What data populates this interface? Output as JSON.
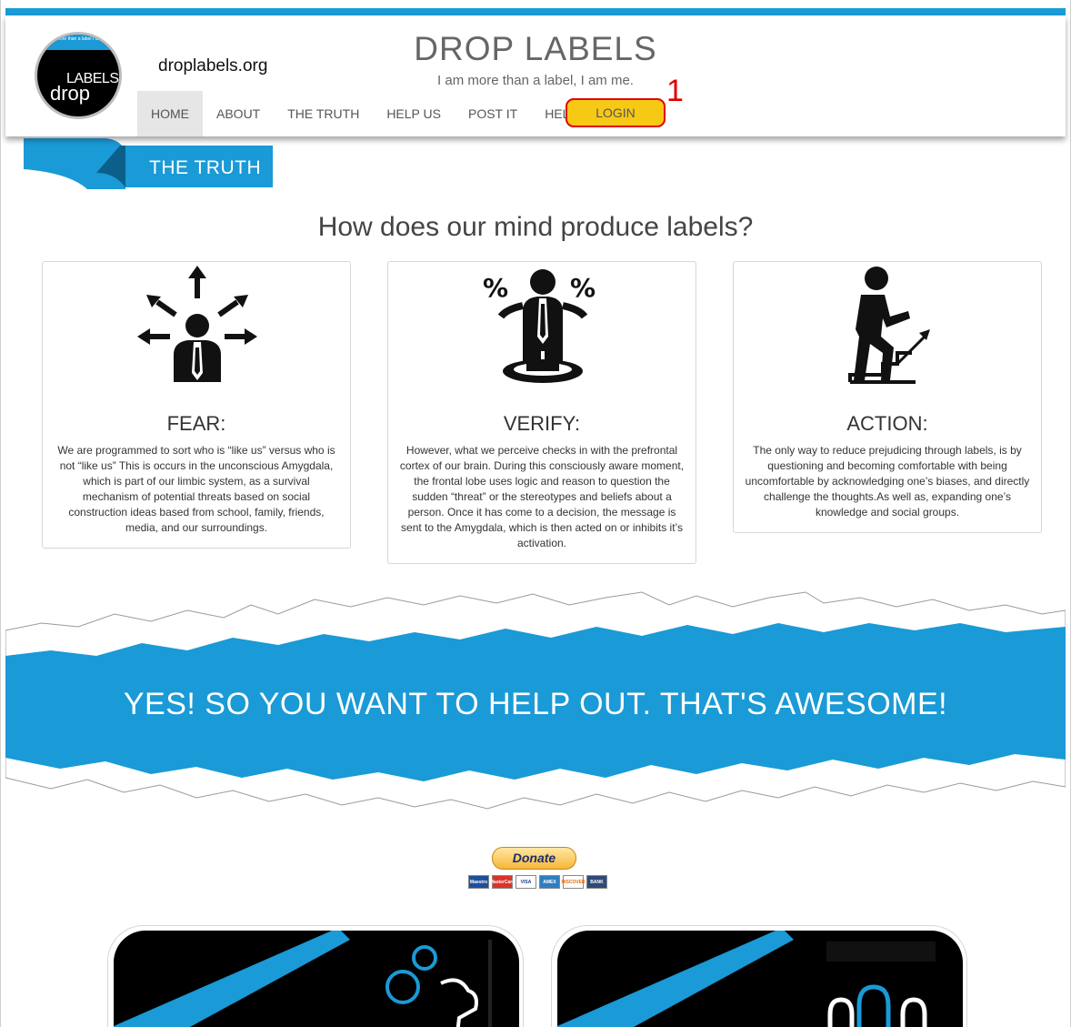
{
  "header": {
    "site_url": "droplabels.org",
    "title": "DROP LABELS",
    "tagline": "I am more than a label, I am me.",
    "logo": {
      "strip_text": "I am more than a label I am me.",
      "word_labels": "LABELS",
      "word_drop": "drop"
    }
  },
  "nav": {
    "items": [
      {
        "label": "HOME",
        "active": true
      },
      {
        "label": "ABOUT"
      },
      {
        "label": "THE TRUTH"
      },
      {
        "label": "HELP US"
      },
      {
        "label": "POST IT"
      },
      {
        "label": "HELP"
      }
    ],
    "login_label": "LOGIN",
    "annotation_number": "1"
  },
  "page_ribbon": {
    "label": "THE TRUTH"
  },
  "section": {
    "title": "How does our mind produce labels?",
    "cards": [
      {
        "icon": "person-arrows-icon",
        "title": "FEAR:",
        "body": "We are programmed to sort who is “like us” versus who is not “like us” This is occurs in the unconscious Amygdala, which is part of our limbic system, as a survival mechanism of potential threats based on social construction ideas based from school, family, friends, media, and our surroundings."
      },
      {
        "icon": "person-percent-icon",
        "title": "VERIFY:",
        "body": "However, what we perceive checks in with the prefrontal cortex of our brain. During this consciously aware moment, the frontal lobe uses logic and reason to question the sudden “threat” or the stereotypes and beliefs about a person. Once it has come to a decision, the message is sent to the Amygdala, which is then acted on or inhibits it’s activation."
      },
      {
        "icon": "person-climbing-stairs-icon",
        "title": "ACTION:",
        "body": "The only way to reduce prejudicing through labels, is by questioning and becoming comfortable with being uncomfortable by acknowledging one’s biases, and directly challenge the thoughts.As well as, expanding one’s knowledge and social groups."
      }
    ]
  },
  "help_band": {
    "text": "YES! SO YOU WANT TO HELP OUT. THAT'S AWESOME!"
  },
  "donate": {
    "button_label": "Donate",
    "payment_cards": [
      "Maestro",
      "MasterCard",
      "VISA",
      "AMEX",
      "DISCOVER",
      "BANK"
    ]
  },
  "colors": {
    "brand_blue": "#1a9ad6",
    "login_yellow": "#f6c915",
    "annotation_red": "#e00000"
  }
}
